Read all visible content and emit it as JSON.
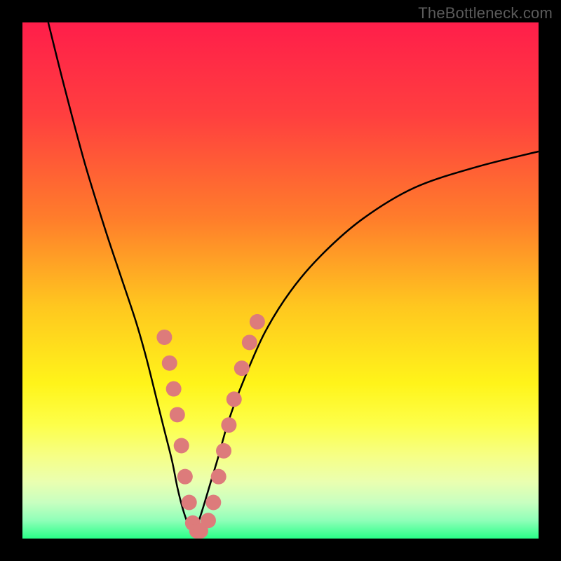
{
  "watermark": "TheBottleneck.com",
  "colors": {
    "page_bg": "#000000",
    "curve_stroke": "#000000",
    "marker_fill": "#dd7b7b",
    "marker_stroke": "#000000",
    "gradient_stops": [
      {
        "offset": 0.0,
        "color": "#ff1e4a"
      },
      {
        "offset": 0.18,
        "color": "#ff3f3f"
      },
      {
        "offset": 0.38,
        "color": "#ff7d2b"
      },
      {
        "offset": 0.55,
        "color": "#ffc71f"
      },
      {
        "offset": 0.7,
        "color": "#fff41a"
      },
      {
        "offset": 0.78,
        "color": "#fdff4a"
      },
      {
        "offset": 0.84,
        "color": "#f6ff86"
      },
      {
        "offset": 0.89,
        "color": "#eaffb0"
      },
      {
        "offset": 0.93,
        "color": "#c8ffc0"
      },
      {
        "offset": 0.965,
        "color": "#8fffb8"
      },
      {
        "offset": 1.0,
        "color": "#29ff88"
      }
    ]
  },
  "chart_data": {
    "type": "line",
    "title": "",
    "xlabel": "",
    "ylabel": "",
    "xlim": [
      0,
      100
    ],
    "ylim": [
      0,
      100
    ],
    "series": [
      {
        "name": "left-branch",
        "x": [
          5,
          8,
          12,
          16,
          19,
          22,
          24,
          26,
          27.5,
          29,
          30,
          31,
          32,
          33
        ],
        "y": [
          100,
          88,
          73,
          60,
          51,
          42,
          35,
          27,
          21,
          15,
          10,
          6,
          3,
          1
        ]
      },
      {
        "name": "right-branch",
        "x": [
          33,
          34,
          35,
          36.5,
          38,
          40,
          43,
          47,
          52,
          58,
          66,
          76,
          88,
          100
        ],
        "y": [
          1,
          3,
          6,
          11,
          16,
          23,
          31,
          40,
          48,
          55,
          62,
          68,
          72,
          75
        ]
      }
    ],
    "markers": {
      "name": "data-points",
      "x": [
        27.5,
        28.5,
        29.3,
        30.0,
        30.8,
        31.5,
        32.3,
        33.0,
        33.8,
        34.5,
        36.0,
        37.0,
        38.0,
        39.0,
        40.0,
        41.0,
        42.5,
        44.0,
        45.5
      ],
      "y": [
        39.0,
        34.0,
        29.0,
        24.0,
        18.0,
        12.0,
        7.0,
        3.0,
        1.5,
        1.5,
        3.5,
        7.0,
        12.0,
        17.0,
        22.0,
        27.0,
        33.0,
        38.0,
        42.0
      ]
    },
    "marker_radius_px": 11
  }
}
